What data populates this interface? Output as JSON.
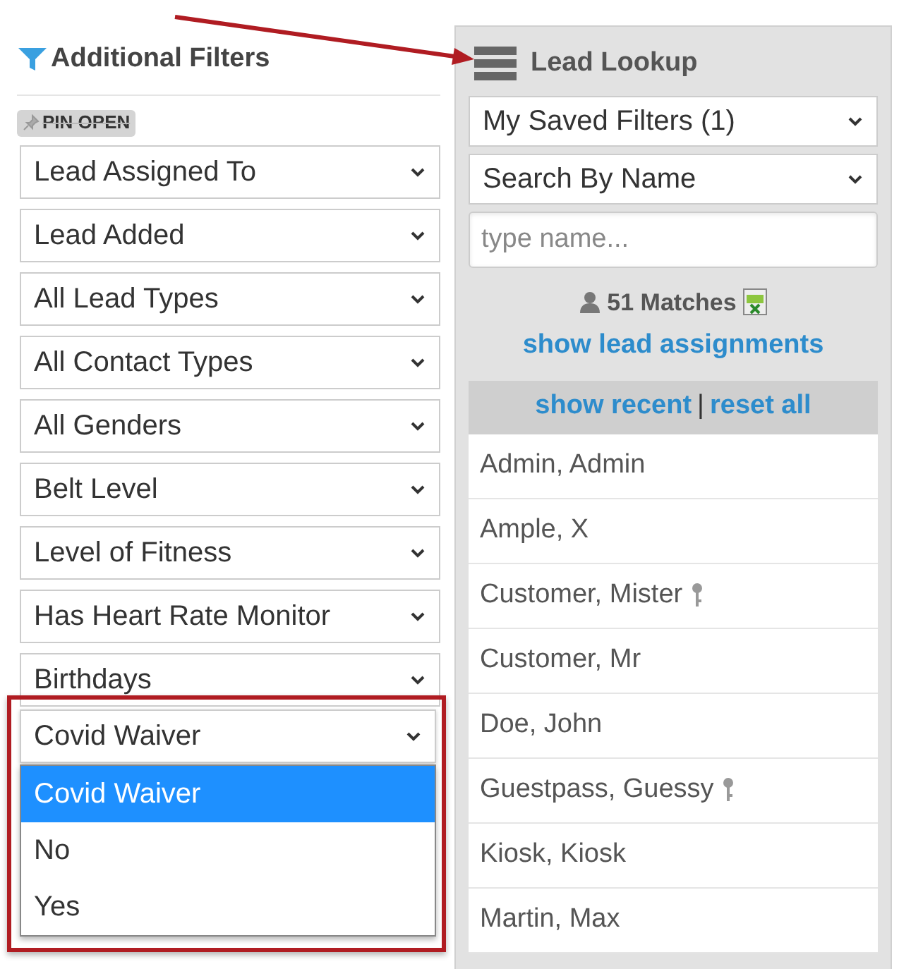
{
  "filters_panel": {
    "title": "Additional Filters",
    "pin_badge": "PIN OPEN",
    "filters": [
      "Lead Assigned To",
      "Lead Added",
      "All Lead Types",
      "All Contact Types",
      "All Genders",
      "Belt Level",
      "Level of Fitness",
      "Has Heart Rate Monitor",
      "Birthdays"
    ],
    "open_filter": {
      "value": "Covid Waiver",
      "options": [
        {
          "label": "Covid Waiver",
          "selected": true
        },
        {
          "label": "No",
          "selected": false
        },
        {
          "label": "Yes",
          "selected": false
        }
      ]
    }
  },
  "lookup_panel": {
    "title": "Lead Lookup",
    "selects": [
      "My Saved Filters (1)",
      "Search By Name"
    ],
    "search": {
      "placeholder": "type name..."
    },
    "matches": "51 Matches",
    "assign_link": "show lead assignments",
    "recent_link": "show recent",
    "separator": "|",
    "reset_link": "reset all",
    "leads": [
      {
        "name": "Admin, Admin",
        "has_key": false
      },
      {
        "name": "Ample, X",
        "has_key": false
      },
      {
        "name": "Customer, Mister",
        "has_key": true
      },
      {
        "name": "Customer, Mr",
        "has_key": false
      },
      {
        "name": "Doe, John",
        "has_key": false
      },
      {
        "name": "Guestpass, Guessy",
        "has_key": true
      },
      {
        "name": "Kiosk, Kiosk",
        "has_key": false
      },
      {
        "name": "Martin, Max",
        "has_key": false
      }
    ]
  }
}
